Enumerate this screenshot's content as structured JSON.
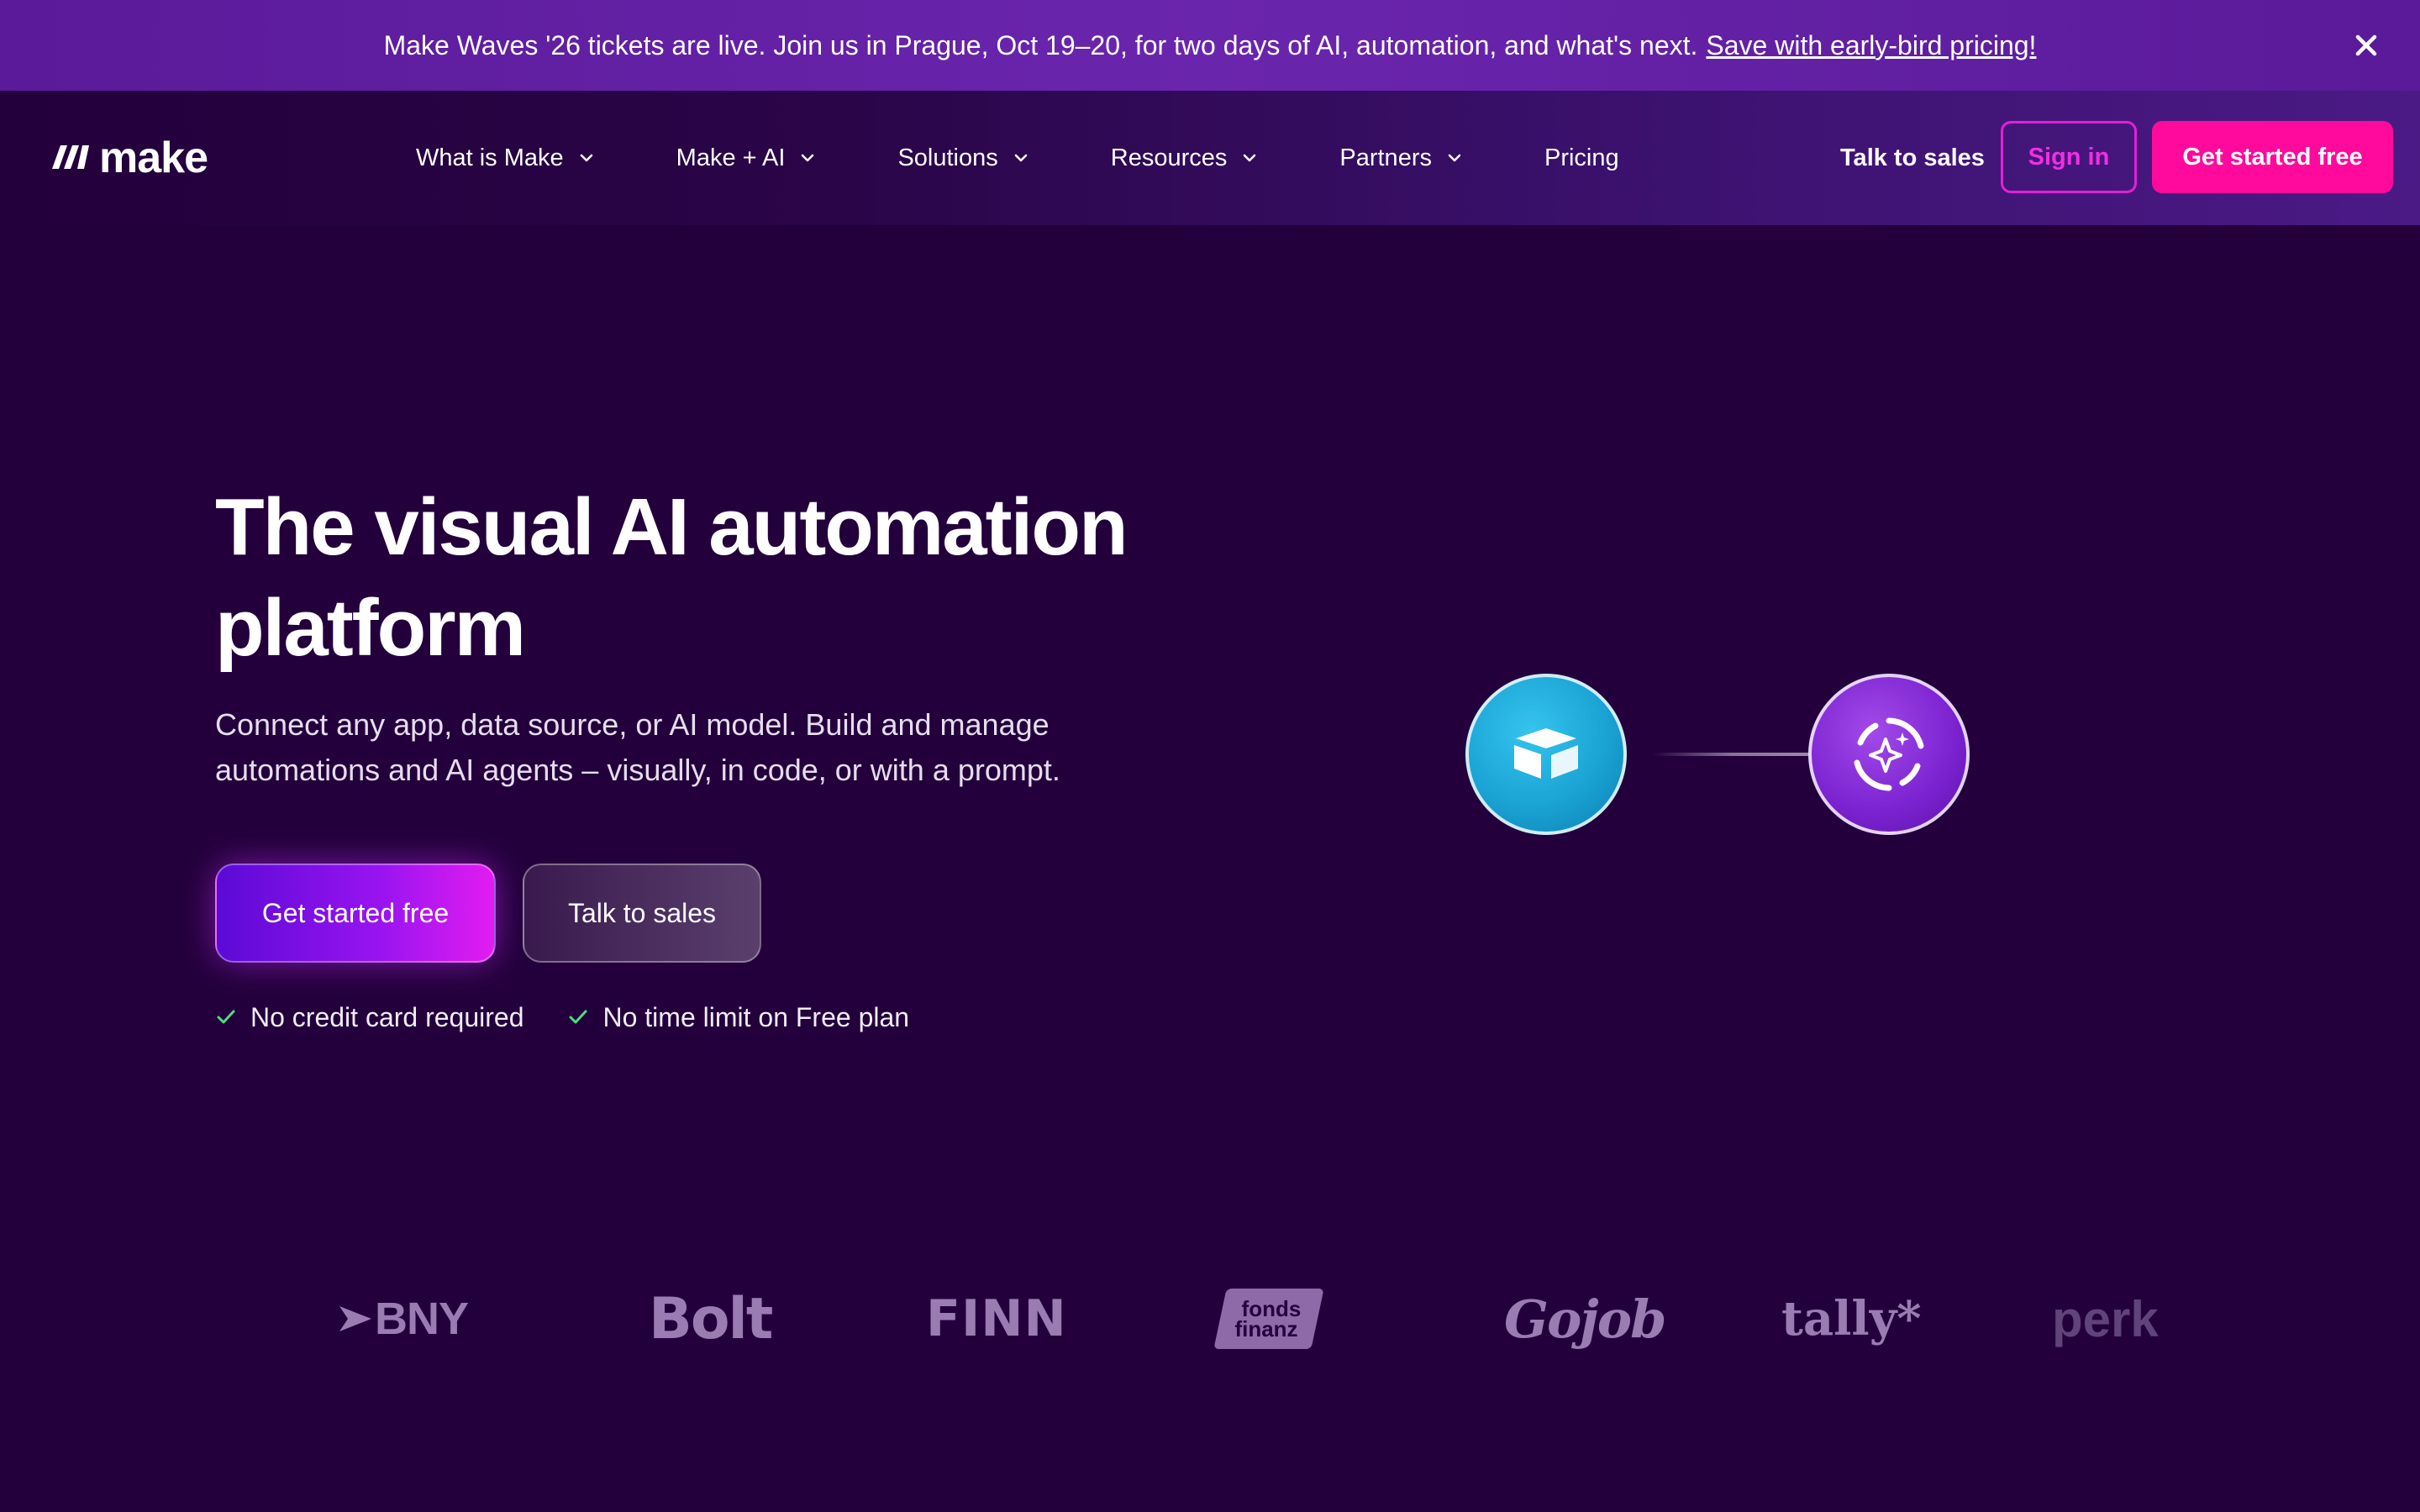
{
  "colors": {
    "background": "#23003b",
    "banner": "#5a1a99",
    "accent_pink": "#ff0a9c",
    "sign_in_border": "#e61ed8",
    "check_green": "#4ade80",
    "logo_gray": "#9a7bb2"
  },
  "banner": {
    "text": "Make Waves '26 tickets are live. Join us in Prague, Oct 19–20, for two days of AI, automation, and what's next.",
    "link_text": "Save with early-bird pricing!",
    "close_icon": "close-icon"
  },
  "header": {
    "logo_text": "make",
    "logo_icon": "make-logo-icon",
    "nav": [
      {
        "label": "What is Make",
        "icon": "chevron-down-icon"
      },
      {
        "label": "Make + AI",
        "icon": "chevron-down-icon"
      },
      {
        "label": "Solutions",
        "icon": "chevron-down-icon"
      },
      {
        "label": "Resources",
        "icon": "chevron-down-icon"
      },
      {
        "label": "Partners",
        "icon": "chevron-down-icon"
      },
      {
        "label": "Pricing"
      }
    ],
    "talk_to_sales": "Talk to sales",
    "sign_in": "Sign in",
    "get_started": "Get started free"
  },
  "hero": {
    "title_line1": "The visual AI automation",
    "title_line2": "platform",
    "subtitle_line1": "Connect any app, data source, or AI model. Build and manage",
    "subtitle_line2": "automations and AI agents – visually, in code, or with a prompt.",
    "primary_cta": "Get started free",
    "secondary_cta": "Talk to sales",
    "perks": [
      "No credit card required",
      "No time limit on Free plan"
    ]
  },
  "illustration": {
    "nodes": [
      {
        "icon": "box-app-icon",
        "color": "#1aa3d4"
      },
      {
        "icon": "ai-sparkle-icon",
        "color": "#7a22d0"
      }
    ]
  },
  "customer_logos": {
    "bny": "BNY",
    "bolt": "Bolt",
    "finn": "FINN",
    "fonds_line1": "fonds",
    "fonds_line2": "finanz",
    "gojob": "Gojob",
    "tally": "tally*",
    "perk": "perk"
  }
}
